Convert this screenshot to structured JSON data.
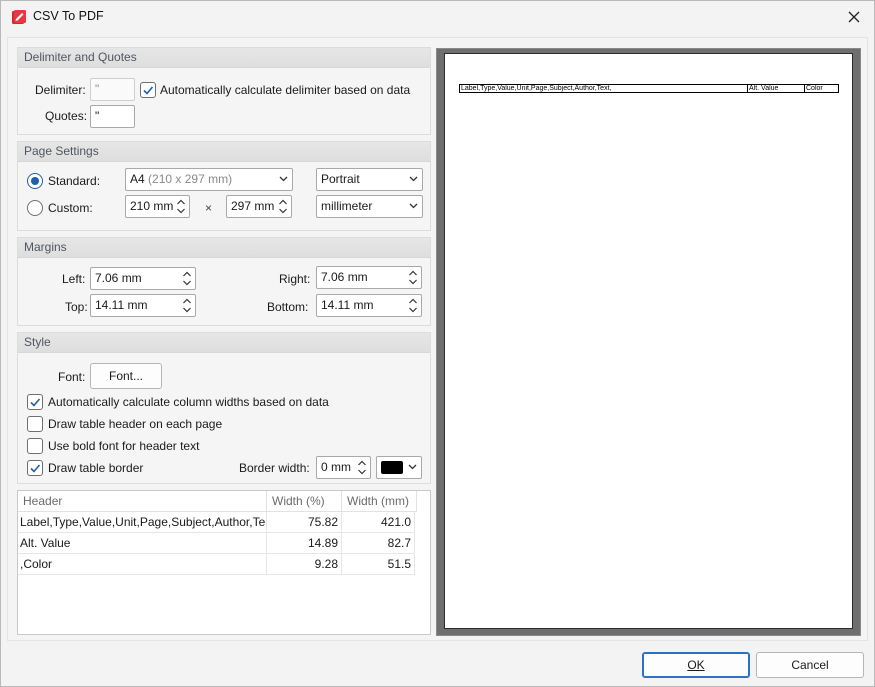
{
  "window": {
    "title": "CSV To PDF"
  },
  "delimiter_quotes": {
    "heading": "Delimiter and Quotes",
    "delimiter_label": "Delimiter:",
    "delimiter_value": "\"",
    "auto_delimiter_label": "Automatically calculate delimiter based on data",
    "auto_delimiter_checked": true,
    "quotes_label": "Quotes:",
    "quotes_value": "\""
  },
  "page_settings": {
    "heading": "Page Settings",
    "standard_label": "Standard:",
    "custom_label": "Custom:",
    "paper_size": "A4",
    "paper_size_detail": "(210 x 297 mm)",
    "orientation": "Portrait",
    "custom_width": "210 mm",
    "times": "×",
    "custom_height": "297 mm",
    "units": "millimeter"
  },
  "margins": {
    "heading": "Margins",
    "left_label": "Left:",
    "left_value": "7.06 mm",
    "right_label": "Right:",
    "right_value": "7.06 mm",
    "top_label": "Top:",
    "top_value": "14.11 mm",
    "bottom_label": "Bottom:",
    "bottom_value": "14.11 mm"
  },
  "style": {
    "heading": "Style",
    "font_label": "Font:",
    "font_button": "Font...",
    "auto_widths_label": "Automatically calculate column widths based on data",
    "auto_widths_checked": true,
    "header_each_page_label": "Draw table header on each page",
    "header_each_page_checked": false,
    "bold_header_label": "Use bold font for header text",
    "bold_header_checked": false,
    "draw_border_label": "Draw table border",
    "draw_border_checked": true,
    "border_width_label": "Border width:",
    "border_width_value": "0 mm",
    "border_color": "#000000"
  },
  "columns_table": {
    "headers": [
      "Header",
      "Width (%)",
      "Width (mm)"
    ],
    "rows": [
      {
        "header": "Label,Type,Value,Unit,Page,Subject,Author,Te..",
        "pct": "75.82",
        "mm": "421.0"
      },
      {
        "header": "Alt. Value",
        "pct": "14.89",
        "mm": "82.7"
      },
      {
        "header": ",Color",
        "pct": "9.28",
        "mm": "51.5"
      }
    ]
  },
  "preview": {
    "cells": [
      "Label,Type,Value,Unit,Page,Subject,Author,Text,",
      "Alt. Value",
      "Color"
    ]
  },
  "footer": {
    "ok_label": "OK",
    "cancel_label": "Cancel"
  }
}
